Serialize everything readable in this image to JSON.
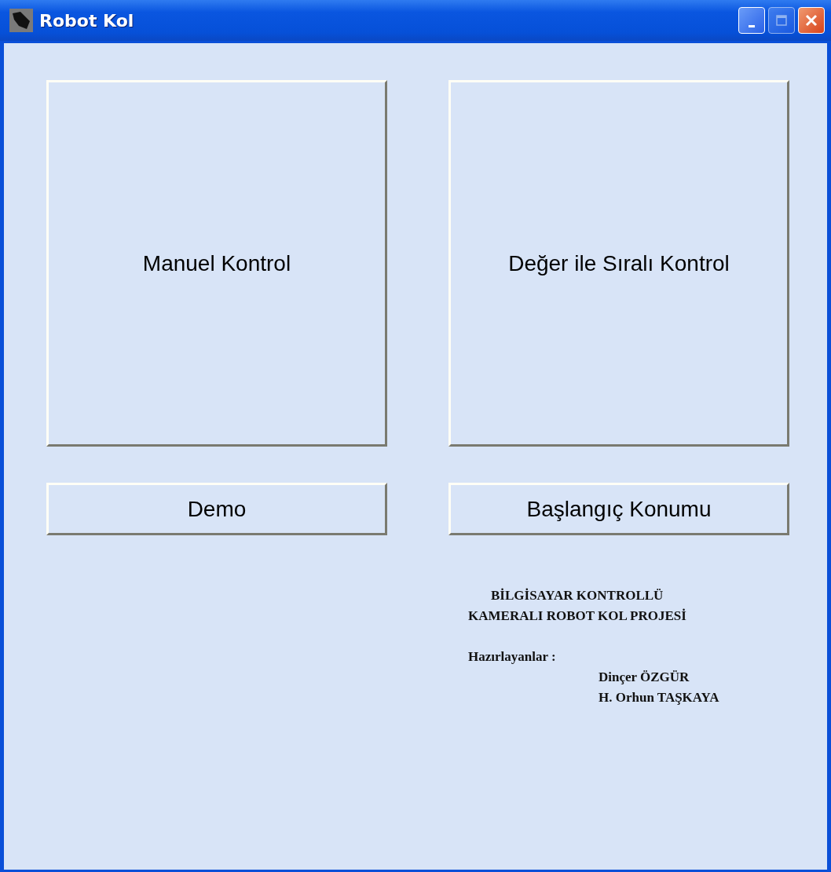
{
  "window": {
    "title": "Robot Kol",
    "controls": [
      {
        "kind": "minimize",
        "disabled": false
      },
      {
        "kind": "maximize",
        "disabled": true
      },
      {
        "kind": "close",
        "disabled": false
      }
    ]
  },
  "large_buttons": [
    {
      "label": "Manuel Kontrol"
    },
    {
      "label": "Değer ile Sıralı Kontrol"
    }
  ],
  "small_buttons": [
    {
      "label": "Demo"
    },
    {
      "label": "Başlangıç Konumu"
    }
  ],
  "project_title": [
    "BİLGİSAYAR KONTROLLÜ",
    "KAMERALI ROBOT KOL PROJESİ"
  ],
  "prepared_by": {
    "label": "Hazırlayanlar :",
    "names": [
      "Dinçer ÖZGÜR",
      "H. Orhun TAŞKAYA"
    ]
  }
}
